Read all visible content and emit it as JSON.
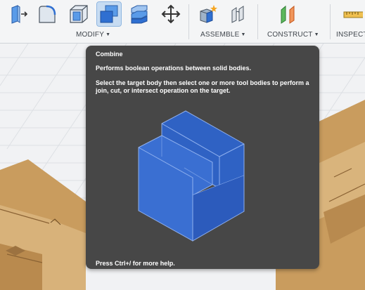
{
  "toolbar": {
    "groups": [
      {
        "label": "MODIFY"
      },
      {
        "label": "ASSEMBLE"
      },
      {
        "label": "CONSTRUCT"
      },
      {
        "label": "INSPECT"
      }
    ]
  },
  "tooltip": {
    "title": "Combine",
    "description": "Performs boolean operations between solid bodies.",
    "instruction": "Select the target body then select one or more tool bodies to perform a join, cut, or intersect operation on the target.",
    "help": "Press Ctrl+/ for more help."
  },
  "colors": {
    "toolbar_bg": "#f4f5f6",
    "tooltip_bg": "#474747",
    "accent_blue": "#2f6fd1",
    "wood": "#c89a5c"
  }
}
